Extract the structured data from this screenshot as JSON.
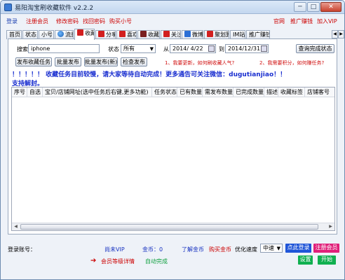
{
  "window": {
    "title": "易阳淘宝刷收藏软件 v2.2.2",
    "min": "─",
    "max": "□",
    "close": "✕"
  },
  "menu": {
    "left": [
      "登录",
      "注册会员",
      "修改密码",
      "找回密码",
      "购买小号"
    ],
    "right": [
      "官网",
      "推广赚钱",
      "加入VIP"
    ]
  },
  "tabs": [
    {
      "label": "首页"
    },
    {
      "label": "状态"
    },
    {
      "label": "小号"
    },
    {
      "label": "流量",
      "icon": "globe"
    },
    {
      "label": "收藏",
      "icon": "red",
      "active": true
    },
    {
      "label": "分享",
      "icon": "red"
    },
    {
      "label": "喜欢",
      "icon": "red"
    },
    {
      "label": "收藏",
      "icon": "dark"
    },
    {
      "label": "关注",
      "icon": "red"
    },
    {
      "label": "微博",
      "icon": "blue"
    },
    {
      "label": "聚划算",
      "icon": "red"
    },
    {
      "label": "IM站"
    },
    {
      "label": "推广赚钱"
    }
  ],
  "filters": {
    "keyword_label": "搜索",
    "keyword_value": "iphone",
    "status_label": "状态",
    "status_value": "所有",
    "from_label": "从",
    "from_date": "2014/ 4/22",
    "to_label": "到",
    "to_date": "2014/12/31",
    "query_button": "查询完成状态"
  },
  "actions": {
    "publish": "发布收藏任务",
    "batch_publish": "批量发布",
    "batch_publish_new": "批量发布(新)",
    "check_publish": "检查发布",
    "tip1": "1、我要更新，如何刷收藏人气?",
    "tip2": "2、我需要积分，如何赚任务?"
  },
  "notice": {
    "line1": "！！！！！ 收藏任务目前较慢，请大家等待自动完成！更多通告可关注微信：dugutianjiao！！",
    "line2": "支持解封。"
  },
  "table": {
    "columns": [
      "序号",
      "自选",
      "宝贝/店铺网址(选中任务后右键,更多功能)",
      "任务状态",
      "已有数量",
      "需发布数量",
      "已完成数量",
      "描述",
      "收藏标签",
      "店铺客号"
    ]
  },
  "bottom": {
    "account_label": "登录账号：",
    "vip": "尚未VIP",
    "gold": "金币：0",
    "learn_gold": "了解金币",
    "buy_gold": "购买金币",
    "prefer_speed": "优化速度",
    "speed_value": "中速",
    "point_login": "点此登录",
    "register": "注册会员",
    "upgrade": "会员等级详情",
    "auto_done": "自动完成",
    "settings": "设置",
    "start": "开始"
  },
  "colors": {
    "red_menu": "#b01010",
    "blue_notice": "#1a2fd0",
    "green_btn": "#10b050",
    "blue_btn": "#1f55d8",
    "pink_btn": "#e0207a"
  }
}
